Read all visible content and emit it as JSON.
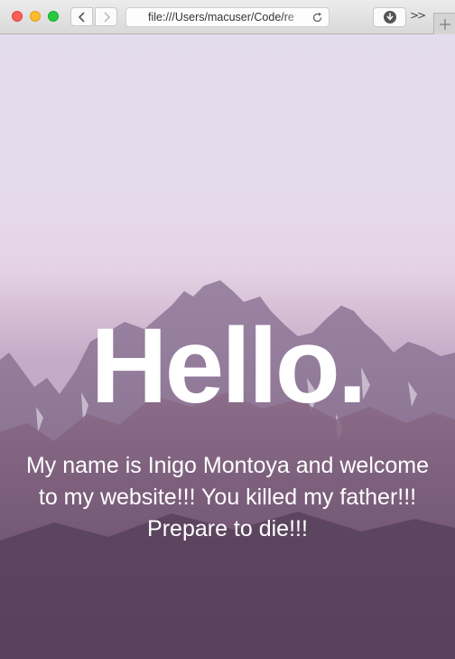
{
  "browser": {
    "url": "file:///Users/macuser/Code/re",
    "overflow_label": ">>"
  },
  "page": {
    "heading": "Hello.",
    "intro": "My name is Inigo Montoya and welcome to my website!!! You killed my father!!! Prepare to die!!!"
  },
  "icons": {
    "back": "chevron-left-icon",
    "forward": "chevron-right-icon",
    "reload": "reload-icon",
    "download": "download-icon",
    "new_tab": "plus-icon"
  },
  "colors": {
    "close": "#fc5f57",
    "minimize": "#fdbc2e",
    "maximize": "#28c840",
    "sky_top": "#e3dcec",
    "mountain": "#8d6f8d",
    "text": "#ffffff"
  }
}
